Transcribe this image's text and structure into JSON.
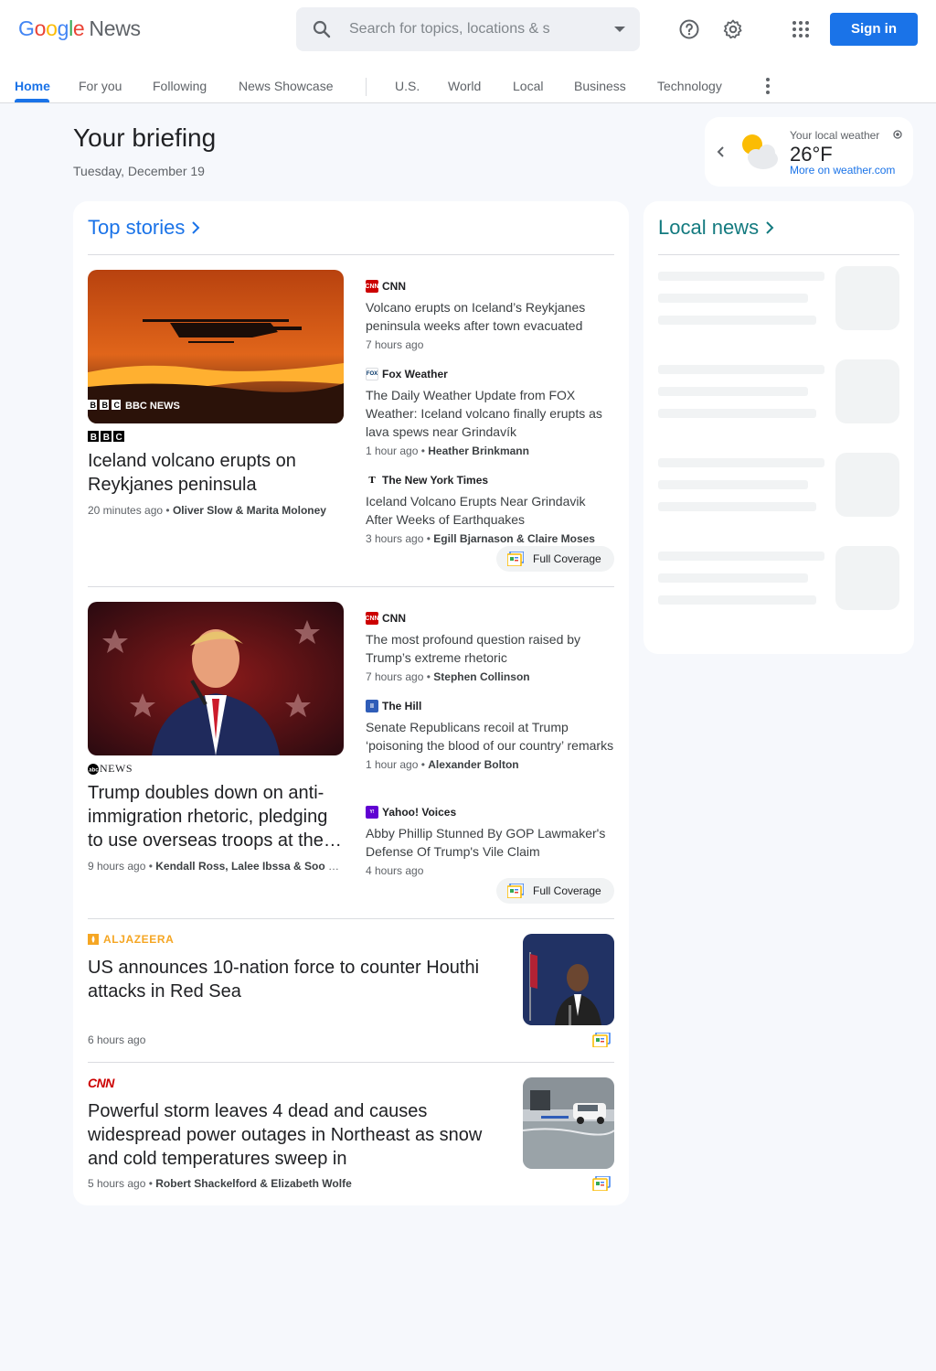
{
  "header": {
    "logo_google": [
      "G",
      "o",
      "o",
      "g",
      "l",
      "e"
    ],
    "logo_news": "News",
    "search_placeholder": "Search for topics, locations & s",
    "signin_label": "Sign in",
    "icons": [
      "search-icon",
      "help-icon",
      "gear-icon",
      "apps-icon"
    ]
  },
  "tabs": [
    {
      "label": "Home",
      "active": true
    },
    {
      "label": "For you"
    },
    {
      "label": "Following"
    },
    {
      "label": "News Showcase"
    },
    {
      "label": "U.S."
    },
    {
      "label": "World"
    },
    {
      "label": "Local"
    },
    {
      "label": "Business"
    },
    {
      "label": "Technology"
    }
  ],
  "briefing": {
    "title": "Your briefing",
    "date": "Tuesday, December 19"
  },
  "weather": {
    "label": "Your local weather",
    "temp": "26°F",
    "link": "More on weather.com"
  },
  "top_stories": {
    "heading": "Top stories",
    "clusters": [
      {
        "hero": {
          "image_label": "BBC NEWS",
          "source": "BBC",
          "title": "Iceland volcano erupts on Reykjanes peninsula",
          "time": "20 minutes ago",
          "author": "Oliver Slow & Marita Moloney"
        },
        "side": [
          {
            "source": "CNN",
            "title": "Volcano erupts on Iceland’s Reykjanes peninsula weeks after town evacuated",
            "time": "7 hours ago",
            "author": ""
          },
          {
            "source": "Fox Weather",
            "title": "The Daily Weather Update from FOX Weather: Iceland volcano finally erupts as lava spews near Grindavík",
            "time": "1 hour ago",
            "author": "Heather Brinkmann"
          },
          {
            "source": "The New York Times",
            "title": "Iceland Volcano Erupts Near Grindavik After Weeks of Earthquakes",
            "time": "3 hours ago",
            "author": "Egill Bjarnason & Claire Moses"
          }
        ],
        "full_coverage": "Full Coverage"
      },
      {
        "hero": {
          "source": "NEWS",
          "title": "Trump doubles down on anti-immigration rhetoric, pledging to use overseas troops at the…",
          "time": "9 hours ago",
          "author": "Kendall Ross, Lalee Ibssa & Soo Ri…"
        },
        "side": [
          {
            "source": "CNN",
            "title": "The most profound question raised by Trump’s extreme rhetoric",
            "time": "7 hours ago",
            "author": "Stephen Collinson"
          },
          {
            "source": "The Hill",
            "title": "Senate Republicans recoil at Trump ‘poisoning the blood of our country’ remarks",
            "time": "1 hour ago",
            "author": "Alexander Bolton"
          },
          {
            "source": "Yahoo! Voices",
            "title": "Abby Phillip Stunned By GOP Lawmaker's Defense Of Trump's Vile Claim",
            "time": "4 hours ago",
            "author": ""
          }
        ],
        "full_coverage": "Full Coverage"
      }
    ],
    "rows": [
      {
        "source": "ALJAZEERA",
        "title": "US announces 10-nation force to counter Houthi attacks in Red Sea",
        "time": "6 hours ago",
        "author": ""
      },
      {
        "source": "CNN",
        "title": "Powerful storm leaves 4 dead and causes widespread power outages in Northeast as snow and cold temperatures sweep in",
        "time": "5 hours ago",
        "author": "Robert Shackelford & Elizabeth Wolfe"
      }
    ]
  },
  "local_news": {
    "heading": "Local news"
  },
  "colors": {
    "accent": "#1a73e8",
    "local_heading": "#137a7f",
    "cnn": "#cc0000",
    "aljazeera": "#f5a623"
  }
}
